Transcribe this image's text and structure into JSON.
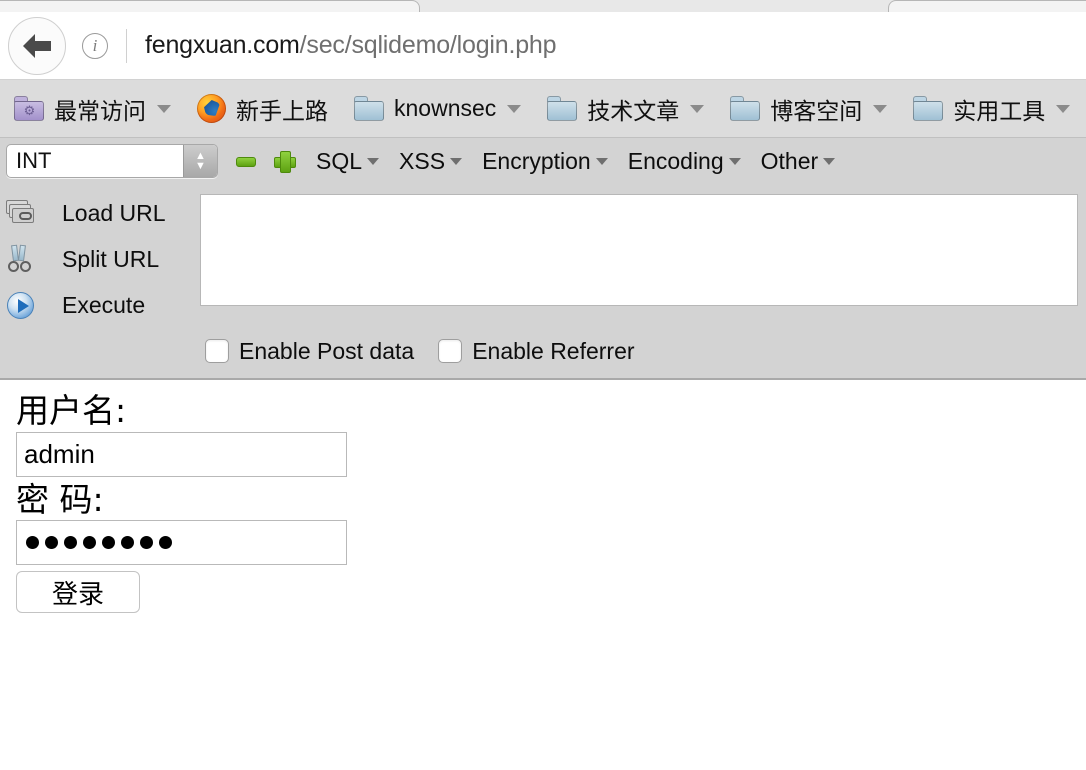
{
  "browser": {
    "back_icon": "back-arrow-icon",
    "info_icon": "info-icon",
    "url_host": "fengxuan.com",
    "url_path": "/sec/sqlidemo/login.php",
    "bookmarks": [
      {
        "label": "最常访问",
        "icon": "folder-gear-icon",
        "has_caret": true
      },
      {
        "label": "新手上路",
        "icon": "firefox-icon",
        "has_caret": false
      },
      {
        "label": "knownsec",
        "icon": "folder-icon",
        "has_caret": true
      },
      {
        "label": "技术文章",
        "icon": "folder-icon",
        "has_caret": true
      },
      {
        "label": "博客空间",
        "icon": "folder-icon",
        "has_caret": true
      },
      {
        "label": "实用工具",
        "icon": "folder-icon",
        "has_caret": true
      }
    ]
  },
  "hackbar": {
    "int_select": {
      "value": "INT",
      "icon": "stepper-icon"
    },
    "minus_icon": "minus-button-icon",
    "plus_icon": "plus-button-icon",
    "menus": [
      {
        "label": "SQL"
      },
      {
        "label": "XSS"
      },
      {
        "label": "Encryption"
      },
      {
        "label": "Encoding"
      },
      {
        "label": "Other"
      }
    ],
    "actions": [
      {
        "label": "Load URL",
        "icon": "load-url-icon"
      },
      {
        "label": "Split URL",
        "icon": "split-url-icon"
      },
      {
        "label": "Execute",
        "icon": "execute-icon"
      }
    ],
    "url_textarea": {
      "value": "",
      "placeholder": ""
    },
    "checkboxes": [
      {
        "label": "Enable Post data",
        "checked": false
      },
      {
        "label": "Enable Referrer",
        "checked": false
      }
    ]
  },
  "page": {
    "username_label": "用户名:",
    "username_value": "admin",
    "password_label": "密 码:",
    "password_dots": 8,
    "submit_label": "登录"
  },
  "colors": {
    "chrome_bookmarks_bg": "#dcdcdc",
    "hackbar_bg": "#d3d3d3",
    "page_bg": "#ffffff",
    "url_host_text": "#1a1a1a",
    "url_path_text": "#6f6f6f",
    "accent_green": "#5ea212",
    "accent_blue": "#3f7ebc"
  }
}
